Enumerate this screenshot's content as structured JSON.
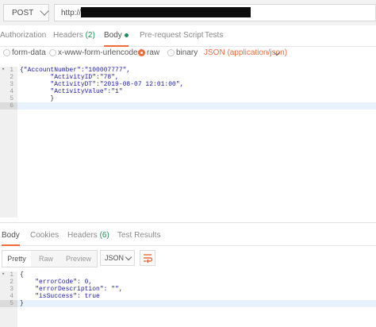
{
  "request": {
    "method": "POST",
    "url": "http://"
  },
  "request_tabs": [
    {
      "label": "Authorization"
    },
    {
      "label": "Headers",
      "count": "(2)"
    },
    {
      "label": "Body",
      "active": true
    },
    {
      "label": "Pre-request Script"
    },
    {
      "label": "Tests"
    }
  ],
  "body_types": {
    "form_data": "form-data",
    "urlencoded": "x-www-form-urlencoded",
    "raw": "raw",
    "binary": "binary",
    "selected": "raw",
    "content_type": "JSON (application/json)"
  },
  "request_body": {
    "line_numbers": [
      "1",
      "2",
      "3",
      "4",
      "5",
      "6"
    ],
    "lines": [
      "{\"AccountNumber\":\"100007777\",",
      "        \"ActivityID\":\"78\",",
      "        \"ActivityDT\":\"2019-08-07 12:01:00\",",
      "        \"ActivityValue\":\"1\"",
      "        }",
      ""
    ]
  },
  "response_tabs": [
    {
      "label": "Body",
      "active": true
    },
    {
      "label": "Cookies"
    },
    {
      "label": "Headers",
      "count": "(6)"
    },
    {
      "label": "Test Results"
    }
  ],
  "response_view": {
    "modes": [
      "Pretty",
      "Raw",
      "Preview"
    ],
    "selected_mode": "Pretty",
    "format": "JSON",
    "wrap_icon": "wrap-lines-icon"
  },
  "response_body": {
    "line_numbers": [
      "1",
      "2",
      "3",
      "4",
      "5"
    ],
    "lines": [
      "{",
      "    \"errorCode\": 0,",
      "    \"errorDescription\": \"\",",
      "    \"isSuccess\": true",
      "}"
    ]
  },
  "colors": {
    "accent": "#f26b3a",
    "count_green": "#1f8e5a",
    "string_blue": "#1a1aa6"
  }
}
